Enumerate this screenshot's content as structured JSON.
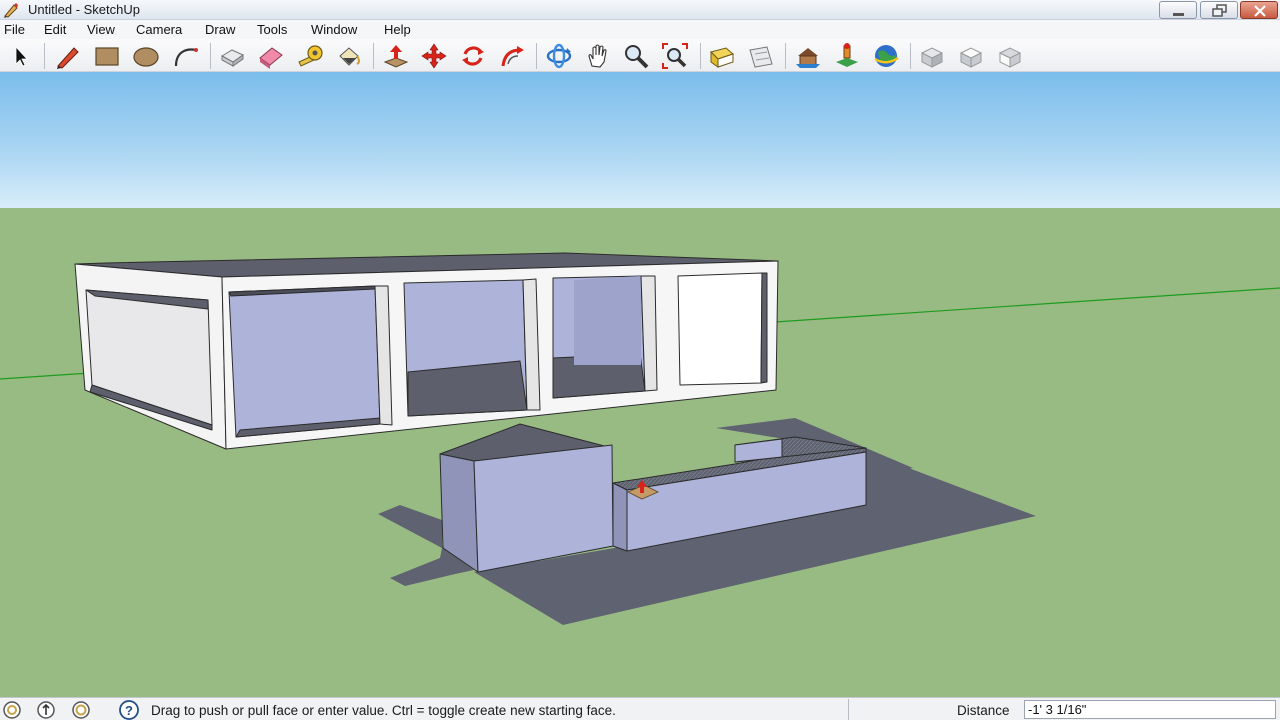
{
  "window": {
    "title": "Untitled - SketchUp",
    "buttons": {
      "minimize": "minimize-icon",
      "restore": "restore-icon",
      "close": "close-icon"
    }
  },
  "menu": {
    "items": [
      "File",
      "Edit",
      "View",
      "Camera",
      "Draw",
      "Tools",
      "Window",
      "Help"
    ]
  },
  "toolbar": {
    "tools": [
      {
        "name": "select",
        "icon": "arrow-cursor-icon"
      },
      {
        "name": "line",
        "icon": "pencil-icon"
      },
      {
        "name": "rectangle",
        "icon": "rectangle-icon"
      },
      {
        "name": "circle",
        "icon": "circle-icon"
      },
      {
        "name": "arc",
        "icon": "arc-icon"
      },
      {
        "name": "make-component",
        "icon": "component-icon"
      },
      {
        "name": "eraser",
        "icon": "eraser-icon"
      },
      {
        "name": "tape-measure",
        "icon": "tape-measure-icon"
      },
      {
        "name": "paint-bucket",
        "icon": "paint-bucket-icon"
      },
      {
        "name": "push-pull",
        "icon": "push-pull-icon"
      },
      {
        "name": "move",
        "icon": "move-icon"
      },
      {
        "name": "rotate",
        "icon": "rotate-icon"
      },
      {
        "name": "follow-me",
        "icon": "follow-me-icon"
      },
      {
        "name": "orbit",
        "icon": "orbit-icon"
      },
      {
        "name": "pan",
        "icon": "hand-icon"
      },
      {
        "name": "zoom",
        "icon": "zoom-icon"
      },
      {
        "name": "zoom-extents",
        "icon": "zoom-extents-icon"
      },
      {
        "name": "previous-view",
        "icon": "previous-view-icon"
      },
      {
        "name": "next-view",
        "icon": "next-view-icon"
      },
      {
        "name": "get-models",
        "icon": "warehouse-icon"
      },
      {
        "name": "share-component",
        "icon": "share-icon"
      },
      {
        "name": "google-earth",
        "icon": "globe-icon"
      },
      {
        "name": "view-iso",
        "icon": "iso-view-icon"
      },
      {
        "name": "view-top",
        "icon": "top-view-icon"
      },
      {
        "name": "view-front",
        "icon": "front-view-icon"
      }
    ]
  },
  "viewport": {
    "sky_color": "#a8d4f2",
    "ground_color": "#98bb84",
    "face_color": "#aeb3da",
    "shadow_color": "#5f6270",
    "green_axis_color": "#1e9b1e"
  },
  "statusbar": {
    "icons": [
      "geo-location-icon",
      "credits-icon",
      "user-icon",
      "help-icon"
    ],
    "message": "Drag to push or pull face or enter value.  Ctrl = toggle create new starting face.",
    "vcb_label": "Distance",
    "vcb_value": "-1' 3 1/16\""
  }
}
